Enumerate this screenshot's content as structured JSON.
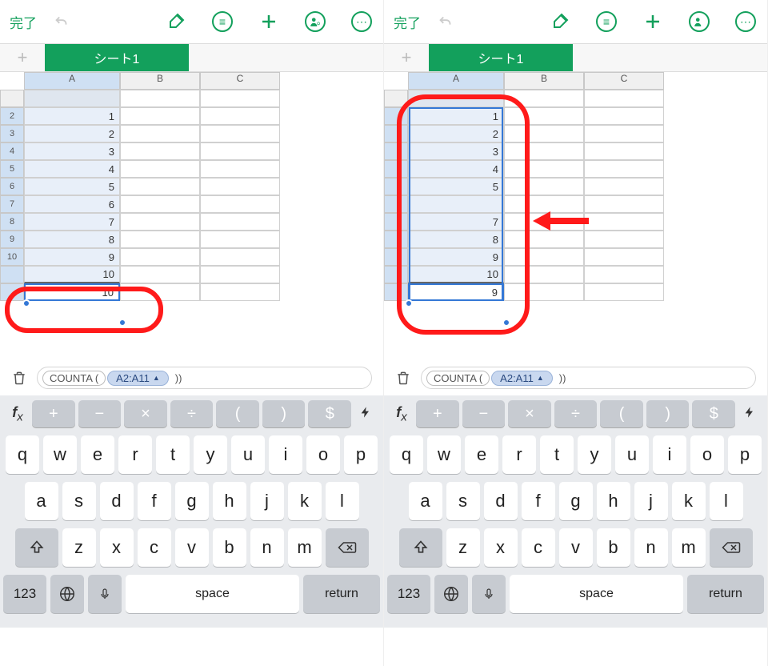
{
  "toolbar": {
    "done": "完了"
  },
  "sheet_tab": "シート1",
  "columns": [
    "A",
    "B",
    "C"
  ],
  "left": {
    "row_numbers": [
      2,
      3,
      4,
      5,
      6,
      7,
      8,
      9,
      10
    ],
    "colA_values": [
      "1",
      "2",
      "3",
      "4",
      "5",
      "6",
      "7",
      "8",
      "9",
      "10"
    ],
    "current_cell_value": "10"
  },
  "right": {
    "row_numbers": [
      "",
      "",
      "",
      "",
      "",
      "",
      "",
      "",
      "",
      ""
    ],
    "colA_values": [
      "1",
      "2",
      "3",
      "4",
      "5",
      "",
      "7",
      "8",
      "9",
      "10"
    ],
    "current_cell_value": "9"
  },
  "formula": {
    "function": "COUNTA",
    "range": "A2:A11",
    "arrow": "▲"
  },
  "fx_label": "fx",
  "op_keys": [
    "+",
    "−",
    "×",
    "÷",
    "(",
    ")",
    "$"
  ],
  "bolt": "⚡",
  "kb_row1": [
    "q",
    "w",
    "e",
    "r",
    "t",
    "y",
    "u",
    "i",
    "o",
    "p"
  ],
  "kb_row2": [
    "a",
    "s",
    "d",
    "f",
    "g",
    "h",
    "j",
    "k",
    "l"
  ],
  "kb_row3": [
    "z",
    "x",
    "c",
    "v",
    "b",
    "n",
    "m"
  ],
  "kb_bottom": {
    "num": "123",
    "space": "space",
    "return": "return"
  }
}
